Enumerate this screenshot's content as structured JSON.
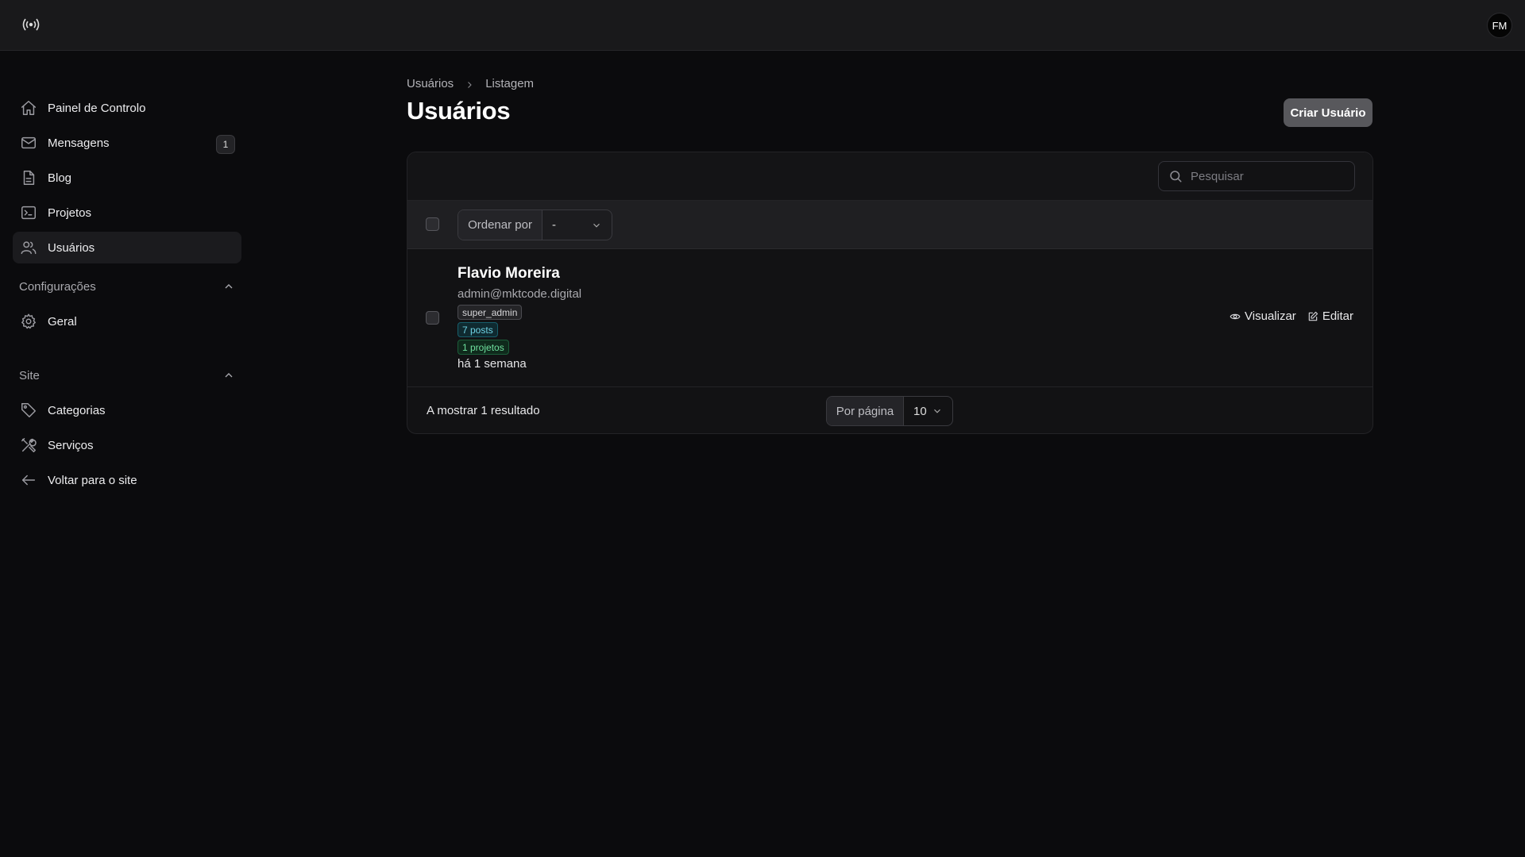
{
  "header": {
    "logo_icon": "broadcast-logo-icon",
    "avatar_initials": "FM"
  },
  "sidebar": {
    "items": [
      {
        "label": "Painel de Controlo",
        "icon": "home-icon"
      },
      {
        "label": "Mensagens",
        "icon": "mail-icon",
        "badge": "1"
      },
      {
        "label": "Blog",
        "icon": "document-icon"
      },
      {
        "label": "Projetos",
        "icon": "terminal-icon"
      },
      {
        "label": "Usuários",
        "icon": "users-icon",
        "active": true
      }
    ],
    "groups": [
      {
        "label": "Configurações",
        "icon": "chevron-up-icon",
        "items": [
          {
            "label": "Geral",
            "icon": "gear-icon"
          }
        ]
      },
      {
        "label": "Site",
        "icon": "chevron-up-icon",
        "items": [
          {
            "label": "Categorias",
            "icon": "tag-icon"
          },
          {
            "label": "Serviços",
            "icon": "tools-icon"
          },
          {
            "label": "Voltar para o site",
            "icon": "arrow-left-icon"
          }
        ]
      }
    ]
  },
  "breadcrumb": [
    "Usuários",
    "Listagem"
  ],
  "page": {
    "title": "Usuários",
    "create_button": "Criar Usuário"
  },
  "table": {
    "search_placeholder": "Pesquisar",
    "sort_label": "Ordenar por",
    "sort_value": "-",
    "rows": [
      {
        "name": "Flavio Moreira",
        "email": "admin@mktcode.digital",
        "tags": [
          "super_admin",
          "7 posts",
          "1 projetos"
        ],
        "time": "há 1 semana",
        "actions": [
          "Visualizar",
          "Editar"
        ]
      }
    ],
    "result_text": "A mostrar 1 resultado",
    "per_page_label": "Por página",
    "per_page_value": "10"
  },
  "colors": {
    "background": "#0b0b0d",
    "primary_button": "#58585c",
    "tag_blue": "#6fd2e4",
    "tag_green": "#6fe09e"
  }
}
